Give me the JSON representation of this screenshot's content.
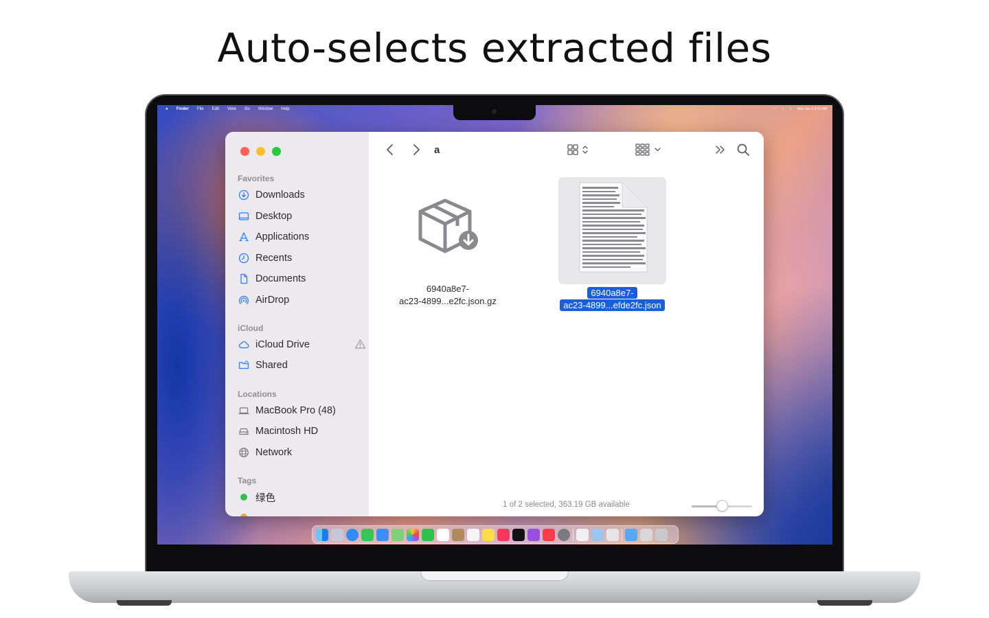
{
  "headline": "Auto-selects extracted files",
  "menubar": {
    "app": "Finder",
    "items": [
      "File",
      "Edit",
      "View",
      "Go",
      "Window",
      "Help"
    ],
    "clock": "Mon Jun 6  9:41 AM"
  },
  "finder": {
    "path_title": "a",
    "sidebar": {
      "favorites_title": "Favorites",
      "favorites": [
        "Downloads",
        "Desktop",
        "Applications",
        "Recents",
        "Documents",
        "AirDrop"
      ],
      "icloud_title": "iCloud",
      "icloud": [
        "iCloud Drive",
        "Shared"
      ],
      "locations_title": "Locations",
      "locations": [
        "MacBook Pro (48)",
        "Macintosh HD",
        "Network"
      ],
      "tags_title": "Tags",
      "tags": [
        {
          "label": "绿色",
          "color": "#2fc14b"
        }
      ]
    },
    "files": [
      {
        "name_line1": "6940a8e7-",
        "name_line2": "ac23-4899...e2fc.json.gz",
        "icon": "archive-package-icon",
        "selected": false
      },
      {
        "name_line1": "6940a8e7-",
        "name_line2": "ac23-4899...efde2fc.json",
        "icon": "json-document-icon",
        "selected": true
      }
    ],
    "status": "1 of 2 selected, 363.19 GB available",
    "zoom_level": 0.5
  },
  "colors": {
    "selection": "#1a5fd9",
    "close": "#fe5f57",
    "minimize": "#febc2e",
    "zoom": "#28c840"
  }
}
